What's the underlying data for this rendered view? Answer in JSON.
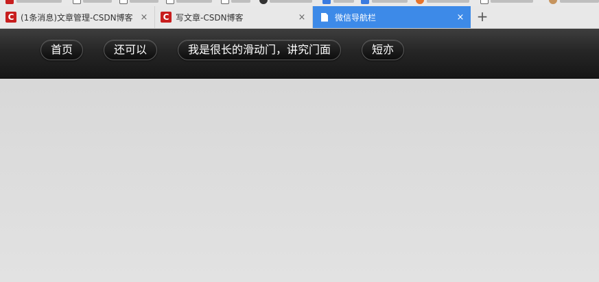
{
  "browser": {
    "tabs": [
      {
        "title": "(1条消息)文章管理-CSDN博客",
        "favicon": "C",
        "active": false
      },
      {
        "title": "写文章-CSDN博客",
        "favicon": "C",
        "active": false
      },
      {
        "title": "微信导航栏",
        "favicon": "document-icon",
        "active": true
      }
    ],
    "close_glyph": "×",
    "new_tab_glyph": "+",
    "accent_color": "#3d8ae8"
  },
  "nav": {
    "items": [
      {
        "label": "首页"
      },
      {
        "label": "还可以"
      },
      {
        "label": "我是很长的滑动门，讲究门面"
      },
      {
        "label": "短亦"
      }
    ]
  }
}
